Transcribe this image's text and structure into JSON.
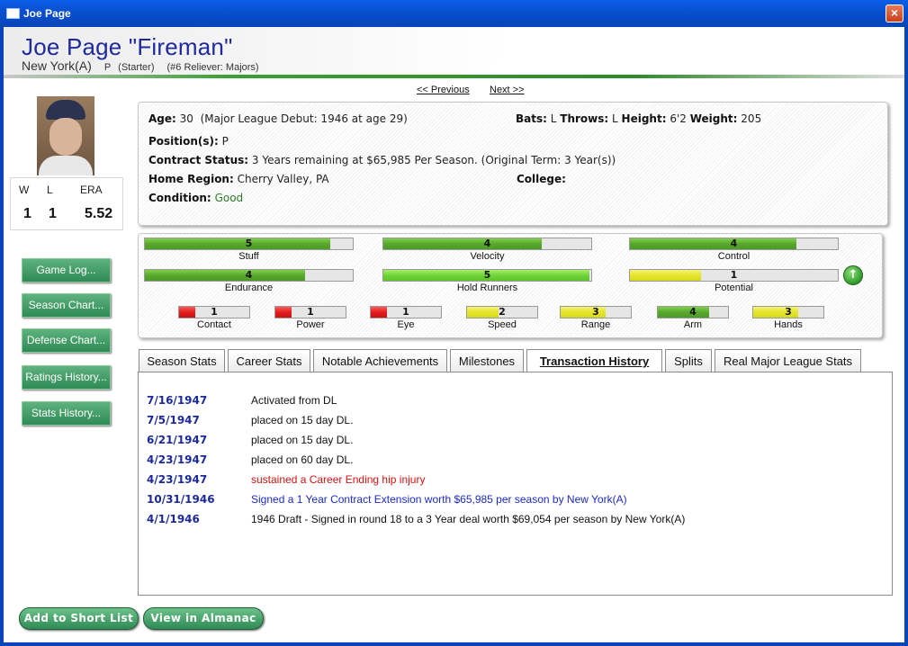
{
  "window": {
    "title": "Joe Page",
    "close_label": "×"
  },
  "header": {
    "name": "Joe Page  \"Fireman\"",
    "team": "New York(A)",
    "position": "P",
    "role": "(Starter)",
    "rank": "(#6 Reliever: Majors)"
  },
  "nav": {
    "previous": "<< Previous",
    "next": "Next >>"
  },
  "pitching": {
    "headers": [
      "W",
      "L",
      "ERA"
    ],
    "values": [
      "1",
      "1",
      "5.52"
    ]
  },
  "side_buttons": [
    "Game Log...",
    "Season Chart...",
    "Defense Chart...",
    "Ratings History...",
    "Stats History..."
  ],
  "bio": {
    "age_label": "Age:",
    "age": "30",
    "debut": "(Major League Debut: 1946 at age 29)",
    "bats_label": "Bats:",
    "bats": "L",
    "throws_label": "Throws:",
    "throws": "L",
    "height_label": "Height:",
    "height": "6'2",
    "weight_label": "Weight:",
    "weight": "205",
    "positions_label": "Position(s):",
    "positions": "P",
    "contract_label": "Contract Status:",
    "contract": "3 Years remaining at $65,985 Per Season. (Original Term: 3 Year(s))",
    "region_label": "Home Region:",
    "region": "Cherry Valley, PA",
    "college_label": "College:",
    "college": "",
    "condition_label": "Condition:",
    "condition": "Good"
  },
  "ratings": {
    "top": [
      {
        "label": "Stuff",
        "value": "5",
        "fraction": 0.89,
        "color": "green"
      },
      {
        "label": "Velocity",
        "value": "4",
        "fraction": 0.76,
        "color": "green"
      },
      {
        "label": "Control",
        "value": "4",
        "fraction": 0.8,
        "color": "green"
      },
      {
        "label": "Endurance",
        "value": "4",
        "fraction": 0.77,
        "color": "green"
      },
      {
        "label": "Hold Runners",
        "value": "5",
        "fraction": 0.99,
        "color": "lime"
      },
      {
        "label": "Potential",
        "value": "1",
        "fraction": 0.34,
        "color": "yellow"
      }
    ],
    "small": [
      {
        "label": "Contact",
        "value": "1",
        "fraction": 0.23,
        "color": "red"
      },
      {
        "label": "Power",
        "value": "1",
        "fraction": 0.23,
        "color": "red"
      },
      {
        "label": "Eye",
        "value": "1",
        "fraction": 0.23,
        "color": "red"
      },
      {
        "label": "Speed",
        "value": "2",
        "fraction": 0.45,
        "color": "yellow"
      },
      {
        "label": "Range",
        "value": "3",
        "fraction": 0.64,
        "color": "yellow"
      },
      {
        "label": "Arm",
        "value": "4",
        "fraction": 0.73,
        "color": "green"
      },
      {
        "label": "Hands",
        "value": "3",
        "fraction": 0.64,
        "color": "yellow"
      }
    ],
    "trend_icon": "up-arrow-icon"
  },
  "tabs": [
    "Season Stats",
    "Career Stats",
    "Notable Achievements",
    "Milestones",
    "Transaction History",
    "Splits",
    "Real Major League Stats"
  ],
  "active_tab": "Transaction History",
  "transactions": [
    {
      "date": "7/16/1947",
      "desc": "Activated from DL",
      "color": "black"
    },
    {
      "date": "7/5/1947",
      "desc": "placed on 15 day DL.",
      "color": "black"
    },
    {
      "date": "6/21/1947",
      "desc": "placed on 15 day DL.",
      "color": "black"
    },
    {
      "date": "4/23/1947",
      "desc": "placed on 60 day DL.",
      "color": "black"
    },
    {
      "date": "4/23/1947",
      "desc": "sustained a Career Ending hip injury",
      "color": "red"
    },
    {
      "date": "10/31/1946",
      "desc": "Signed a 1 Year Contract Extension worth $65,985 per season by New York(A)",
      "color": "blue"
    },
    {
      "date": "4/1/1946",
      "desc": "1946 Draft - Signed in round 18 to a 3 Year deal worth $69,054 per season by New York(A)",
      "color": "black"
    }
  ],
  "bottom_buttons": {
    "short_list": "Add to Short List",
    "almanac": "View in Almanac"
  }
}
